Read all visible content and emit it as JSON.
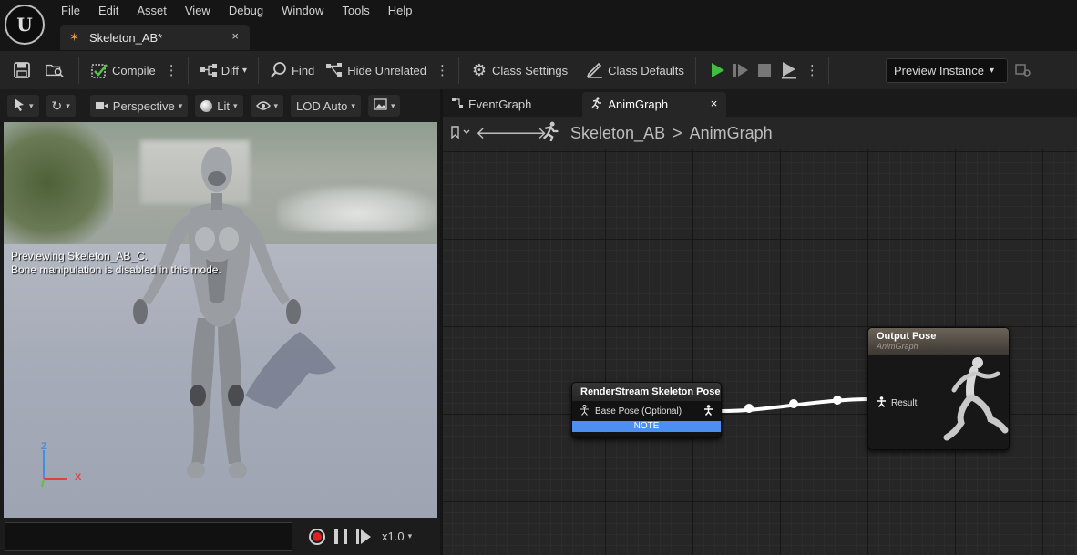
{
  "app": {
    "logo_letter": "U",
    "menu": [
      "File",
      "Edit",
      "Asset",
      "View",
      "Debug",
      "Window",
      "Tools",
      "Help"
    ],
    "document_tab": {
      "title": "Skeleton_AB*",
      "close": "×"
    }
  },
  "toolbar": {
    "compile_label": "Compile",
    "diff_label": "Diff",
    "find_label": "Find",
    "hide_unrelated_label": "Hide Unrelated",
    "class_settings_label": "Class Settings",
    "class_defaults_label": "Class Defaults",
    "preview_instance_label": "Preview Instance",
    "accent_play": "#3fbf3f"
  },
  "viewport": {
    "perspective_label": "Perspective",
    "lit_label": "Lit",
    "lod_label": "LOD Auto",
    "info_line1": "Previewing Skeleton_AB_C.",
    "info_line2": "Bone manipulation is disabled in this mode.",
    "axis_z": "Z",
    "axis_x": "X",
    "playback_speed": "x1.0",
    "axis_colors": {
      "x": "#e04040",
      "y": "#60c040",
      "z": "#4090e0"
    }
  },
  "graph": {
    "tabs": [
      {
        "label": "EventGraph",
        "active": false
      },
      {
        "label": "AnimGraph",
        "active": true,
        "close": "×"
      }
    ],
    "breadcrumb": [
      "Skeleton_AB",
      "AnimGraph"
    ],
    "breadcrumb_sep": ">",
    "nodes": {
      "render_stream": {
        "title": "RenderStream Skeleton Pose",
        "pin_label": "Base Pose (Optional)",
        "note_label": "NOTE"
      },
      "output_pose": {
        "title": "Output Pose",
        "subtitle": "AnimGraph",
        "pin_label": "Result"
      }
    }
  }
}
